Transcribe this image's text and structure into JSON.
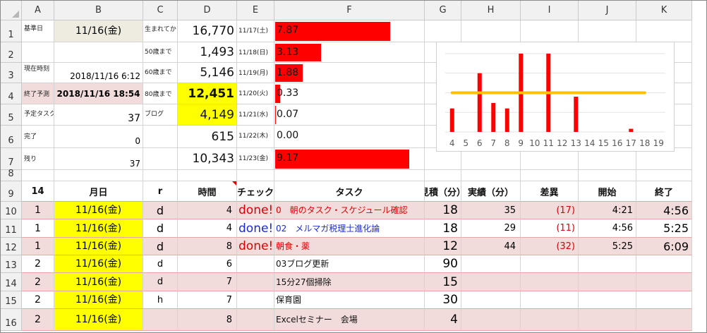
{
  "columns": [
    "A",
    "B",
    "C",
    "D",
    "E",
    "F",
    "G",
    "H",
    "I",
    "J",
    "K"
  ],
  "rows": [
    "1",
    "2",
    "3",
    "4",
    "5",
    "6",
    "7",
    "8",
    "9",
    "10",
    "11",
    "12",
    "13",
    "14",
    "15",
    "16"
  ],
  "top_labels": {
    "base_date_label": "基準日",
    "base_date": "11/16(金)",
    "since_birth_label": "生まれてから",
    "since_birth": "16,770",
    "until50_label": "50歳まで",
    "until50": "1,493",
    "now_label": "現在時刻",
    "now": "2018/11/16 6:12",
    "until60_label": "60歳まで",
    "until60": "5,146",
    "end_pred_label": "終了予測",
    "end_pred": "2018/11/16 18:54",
    "until80_label": "80歳まで",
    "until80": "12,451",
    "planned_label": "予定タスク",
    "planned": "37",
    "blog_label": "ブログ",
    "blog": "4,149",
    "done_label": "完了",
    "done": "0",
    "d6": "615",
    "remain_label": "残り",
    "remain": "37",
    "d7": "10,343"
  },
  "daily": [
    {
      "date": "11/17(土)",
      "value": "7.87",
      "ratio": 7.87
    },
    {
      "date": "11/18(日)",
      "value": "3.13",
      "ratio": 3.13
    },
    {
      "date": "11/19(月)",
      "value": "1.88",
      "ratio": 1.88
    },
    {
      "date": "11/20(火)",
      "value": "0.33",
      "ratio": 0.33
    },
    {
      "date": "11/21(水)",
      "value": "0.07",
      "ratio": 0.07
    },
    {
      "date": "11/22(木)",
      "value": "0.00",
      "ratio": 0.0
    },
    {
      "date": "11/23(金)",
      "value": "9.17",
      "ratio": 9.17
    }
  ],
  "chart_data": {
    "type": "bar",
    "categories": [
      "4",
      "5",
      "6",
      "7",
      "8",
      "9",
      "10",
      "11",
      "12",
      "13",
      "14",
      "15",
      "16",
      "17",
      "18",
      "19"
    ],
    "values": [
      30,
      0,
      75,
      37,
      30,
      100,
      0,
      100,
      0,
      45,
      0,
      0,
      0,
      4,
      0,
      0
    ],
    "line_value": 50,
    "ylim": [
      0,
      100
    ],
    "grid": true,
    "colors": {
      "bars": "#ff0000",
      "line": "#ffc000"
    }
  },
  "table": {
    "headers": [
      "14",
      "月日",
      "r",
      "時間",
      "チェック",
      "タスク",
      "見積（分）",
      "実績（分）",
      "差異",
      "開始",
      "終了"
    ],
    "rows": [
      {
        "a": "1",
        "date": "11/16(金)",
        "r": "d",
        "time": "4",
        "check": "done!",
        "check_color": "red",
        "task": "0　朝のタスク・スケジュール確認",
        "task_color": "red",
        "est": "18",
        "actual": "35",
        "diff": "(17)",
        "start": "4:21",
        "end": "4:56",
        "pink": true
      },
      {
        "a": "1",
        "date": "11/16(金)",
        "r": "d",
        "time": "4",
        "check": "done!",
        "check_color": "blue",
        "task": "02　メルマガ税理士進化論",
        "task_color": "blue",
        "est": "18",
        "actual": "29",
        "diff": "(11)",
        "start": "4:56",
        "end": "5:25",
        "pink": false
      },
      {
        "a": "1",
        "date": "11/16(金)",
        "r": "d",
        "time": "8",
        "check": "done!",
        "check_color": "red",
        "task": "朝食・薬",
        "task_color": "red",
        "est": "12",
        "actual": "44",
        "diff": "(32)",
        "start": "5:25",
        "end": "6:09",
        "pink": true
      },
      {
        "a": "2",
        "date": "11/16(金)",
        "r": "d",
        "time": "6",
        "check": "",
        "check_color": "",
        "task": "03ブログ更新",
        "task_color": "",
        "est": "90",
        "actual": "",
        "diff": "",
        "start": "",
        "end": "",
        "pink": false
      },
      {
        "a": "2",
        "date": "11/16(金)",
        "r": "d",
        "time": "7",
        "check": "",
        "check_color": "",
        "task": "15分27個掃除",
        "task_color": "",
        "est": "15",
        "actual": "",
        "diff": "",
        "start": "",
        "end": "",
        "pink": true
      },
      {
        "a": "2",
        "date": "11/16(金)",
        "r": "h",
        "time": "7",
        "check": "",
        "check_color": "",
        "task": "保育園",
        "task_color": "",
        "est": "30",
        "actual": "",
        "diff": "",
        "start": "",
        "end": "",
        "pink": false
      },
      {
        "a": "2",
        "date": "11/16(金)",
        "r": "",
        "time": "8",
        "check": "",
        "check_color": "",
        "task": "Excelセミナー　会場",
        "task_color": "",
        "est": "4",
        "actual": "",
        "diff": "",
        "start": "",
        "end": "",
        "pink": true
      }
    ]
  }
}
